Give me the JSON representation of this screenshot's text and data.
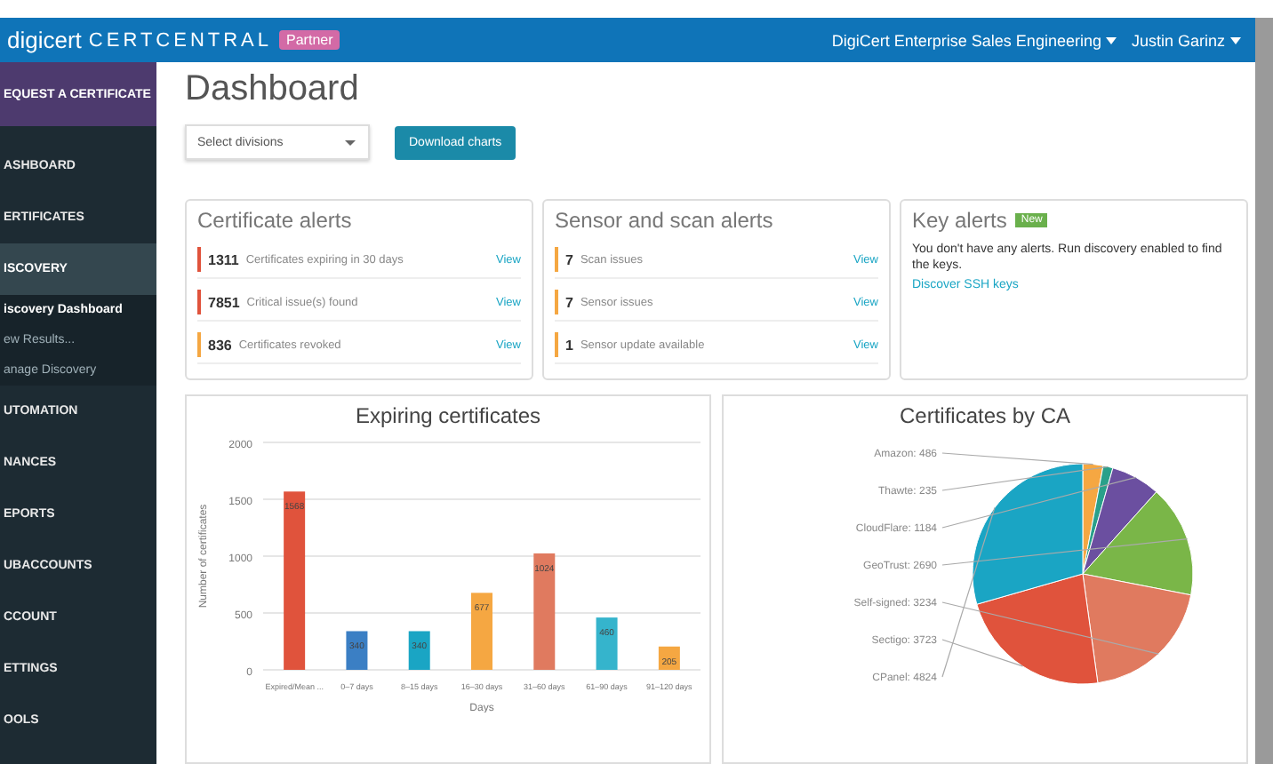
{
  "header": {
    "logo": "digicert",
    "product": "CERTCENTRAL",
    "badge": "Partner",
    "division": "DigiCert Enterprise Sales Engineering",
    "user": "Justin Garinz"
  },
  "sidebar": {
    "request_button": "EQUEST A CERTIFICATE",
    "items": [
      {
        "label": "ASHBOARD",
        "selected": false
      },
      {
        "label": "ERTIFICATES",
        "selected": false
      },
      {
        "label": "ISCOVERY",
        "selected": true,
        "children": [
          {
            "label": "iscovery Dashboard",
            "selected": true
          },
          {
            "label": "ew Results...",
            "selected": false
          },
          {
            "label": "anage Discovery",
            "selected": false
          }
        ]
      },
      {
        "label": "UTOMATION",
        "selected": false
      },
      {
        "label": "NANCES",
        "selected": false
      },
      {
        "label": "EPORTS",
        "selected": false
      },
      {
        "label": "UBACCOUNTS",
        "selected": false
      },
      {
        "label": "CCOUNT",
        "selected": false
      },
      {
        "label": "ETTINGS",
        "selected": false
      },
      {
        "label": "OOLS",
        "selected": false
      }
    ]
  },
  "page_title": "Dashboard",
  "division_select": {
    "placeholder": "Select divisions"
  },
  "download_button": "Download charts",
  "cards": [
    {
      "kind": "alerts",
      "title": "Certificate alerts",
      "rows": [
        {
          "count": "1311",
          "text": "Certificates expiring in 30 days",
          "link": "View",
          "color": "#e0533c"
        },
        {
          "count": "7851",
          "text": "Critical issue(s) found",
          "link": "View",
          "color": "#e0533c"
        },
        {
          "count": "836",
          "text": "Certificates revoked",
          "link": "View",
          "color": "#f5a742"
        }
      ]
    },
    {
      "kind": "alerts",
      "title": "Sensor and scan alerts",
      "rows": [
        {
          "count": "7",
          "text": "Scan issues",
          "link": "View",
          "color": "#f5a742"
        },
        {
          "count": "7",
          "text": "Sensor issues",
          "link": "View",
          "color": "#f5a742"
        },
        {
          "count": "1",
          "text": "Sensor update available",
          "link": "View",
          "color": "#f5a742"
        }
      ]
    },
    {
      "kind": "message",
      "title": "Key alerts",
      "badge": "New",
      "text": "You don't have any alerts. Run discovery enabled to find the keys.",
      "link": "Discover SSH keys"
    }
  ],
  "charts": [
    {
      "title": "Expiring certificates",
      "chart_data": {
        "type": "bar",
        "xlabel": "Days",
        "ylabel": "Number of certificates",
        "categories": [
          "Expired/Mean ...",
          "0–7 days",
          "8–15 days",
          "16–30 days",
          "31–60 days",
          "61–90 days",
          "91–120 days"
        ],
        "colors": [
          "#e0533c",
          "#3b7fc4",
          "#1aa5c4",
          "#f5a742",
          "#e07a5f",
          "#35b4cc",
          "#f5a742"
        ],
        "series": [
          {
            "values": [
              1568,
              340,
              340,
              677,
              1024,
              460,
              205
            ]
          }
        ],
        "ylim": [
          0,
          2000
        ],
        "yticks": [
          0,
          500,
          1000,
          1500,
          2000
        ],
        "grid": true,
        "data_labels": true
      }
    },
    {
      "title": "Certificates by CA",
      "chart_data": {
        "type": "pie",
        "series": [
          {
            "values": [
              2.97,
              1.44,
              7.23,
              16.43,
              19.75,
              22.73,
              29.45
            ]
          }
        ],
        "value_labels": [
          "Amazon: 486",
          "Thawte: 235",
          "CloudFlare: 1184",
          "GeoTrust: 2690",
          "Self-signed: 3234",
          "Sectigo: 3723",
          "CPanel: 4824"
        ]
      }
    }
  ]
}
